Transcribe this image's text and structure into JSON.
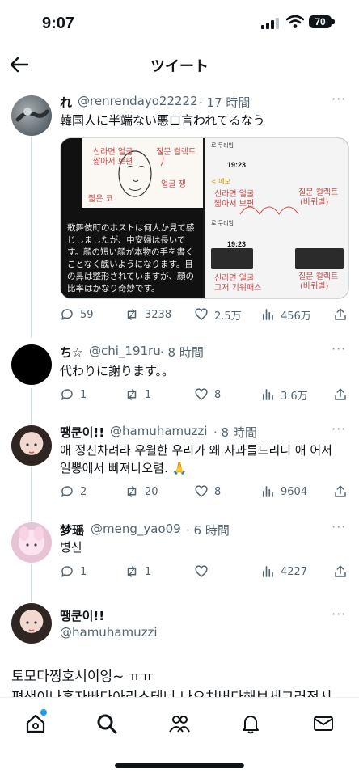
{
  "status_bar": {
    "time": "9:07",
    "battery": "70"
  },
  "header": {
    "title": "ツイート"
  },
  "tweets": [
    {
      "name": "れ",
      "handle": "@renrendayo22222",
      "time": "· 17 時間",
      "text": "韓国人に半端ない悪口言われてるなう",
      "media": {
        "top_strip": "로 무리임",
        "phone_time": "19:23",
        "phone_back": "< 메모",
        "phone_caption": "로 무리임",
        "phone_time_2": "19:23",
        "jp_text": "歌舞伎町のホストは何人か見て感じしましたが、中安婦は長いです。顔の短い顔が本物の手を書くことなく醜いようになります。目の鼻は整形されていますが、顔の比率はかなり奇妙です。",
        "korean_scribbles": [
          "신라면 얼굴",
          "짧아서 보편",
          "그저 기워패스",
          "질문 컬렉트",
          "(바퀴벌)",
          "짧은 코",
          "얼굴 쟁"
        ]
      },
      "stats": {
        "replies": "59",
        "retweets": "3238",
        "likes": "2.5万",
        "views": "456万"
      }
    },
    {
      "name": "ち☆",
      "handle": "@chi_191ru",
      "time": "· 8 時間",
      "text": "代わりに謝ります。。",
      "stats": {
        "replies": "1",
        "retweets": "1",
        "likes": "8",
        "views": "3.6万"
      }
    },
    {
      "name": "땡쿤이!!",
      "handle": "@hamuhamuzzi",
      "time": "· 8 時間",
      "text": "애 정신차려라 우월한 우리가 왜 사과를드리니 애 어서일뽕에서 빠져나오렴. 🙏",
      "stats": {
        "replies": "2",
        "retweets": "20",
        "likes": "8",
        "views": "9604"
      }
    },
    {
      "name": "梦瑶",
      "handle": "@meng_yao09",
      "time": "· 6 時間",
      "text": "병신",
      "stats": {
        "replies": "1",
        "retweets": "1",
        "likes": "",
        "views": "4227"
      }
    }
  ],
  "focused_tweet": {
    "name": "땡쿤이!!",
    "handle": "@hamuhamuzzi",
    "text_line1": "토모다찡호시이잉~ ㅠㅠ",
    "text_line2": "편생이나혼자빠다아리스테니.나오쳐버다해보세그러전시"
  },
  "colors": {
    "accent": "#1d9bf0",
    "text": "#0f1419",
    "secondary": "#536471",
    "line": "#cfd9de"
  },
  "icons": [
    "back-arrow-icon",
    "more-icon",
    "reply-icon",
    "retweet-icon",
    "like-icon",
    "views-icon",
    "share-icon",
    "home-icon",
    "search-icon",
    "communities-icon",
    "notifications-icon",
    "messages-icon"
  ]
}
